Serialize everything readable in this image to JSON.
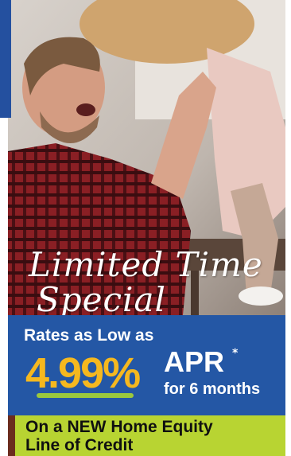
{
  "headline": {
    "line1": "Limited Time",
    "line2": "Special"
  },
  "offer": {
    "intro": "Rates as Low as",
    "rate": "4.99%",
    "rate_label": "APR",
    "asterisk": "*",
    "term": "for 6 months"
  },
  "product": {
    "line1": "On a NEW Home Equity",
    "line2": "Line of Credit"
  },
  "colors": {
    "panel_blue": "#2457a5",
    "rate_gold": "#f5b81f",
    "accent_green": "#b8d432"
  }
}
